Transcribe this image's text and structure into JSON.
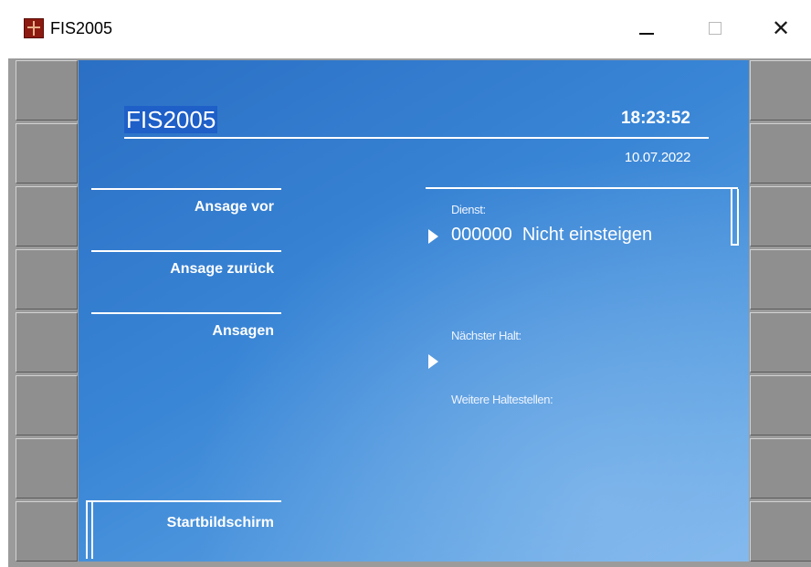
{
  "window": {
    "title": "FIS2005",
    "icon": "fis-app-icon",
    "controls": {
      "minimize": "minimize-icon",
      "maximize": "maximize-icon",
      "close": "close-icon"
    }
  },
  "screen": {
    "logo": "FIS2005",
    "time": "18:23:52",
    "date": "10.07.2022",
    "menu": {
      "ansage_vor": "Ansage vor",
      "ansage_zurueck": "Ansage zurück",
      "ansagen": "Ansagen",
      "startbildschirm": "Startbildschirm"
    },
    "info": {
      "dienst_label": "Dienst:",
      "dienst_value": "000000  Nicht einsteigen",
      "naechster_halt_label": "Nächster Halt:",
      "naechster_halt_value": "",
      "weitere_label": "Weitere Haltestellen:"
    }
  },
  "colors": {
    "screen_blue": "#2a6fc4",
    "screen_blue_light": "#7ab4ec",
    "frame_gray": "#8f8f8f",
    "text": "#ffffff"
  }
}
